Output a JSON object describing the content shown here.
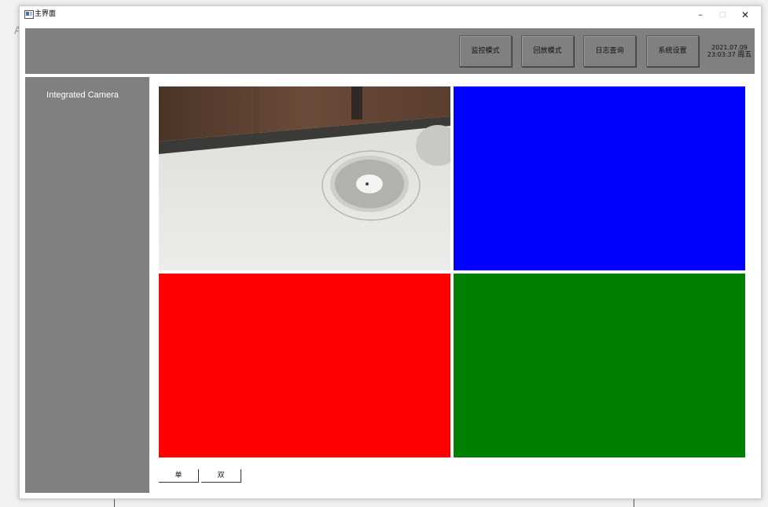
{
  "background": {
    "letter": "A"
  },
  "window": {
    "title": "主界面",
    "controls": {
      "minimize": "–",
      "maximize": "□",
      "close": "✕"
    }
  },
  "toolbar": {
    "buttons": [
      "监控模式",
      "回放模式",
      "日志查询",
      "系统设置"
    ],
    "date": "2021.07.09",
    "time": "23:03:37",
    "weekday": "周五"
  },
  "sidebar": {
    "items": [
      "Integrated Camera"
    ]
  },
  "video_grid": {
    "cells": [
      {
        "content": "camera-feed"
      },
      {
        "color": "#0000ff"
      },
      {
        "color": "#ff0000"
      },
      {
        "color": "#008000"
      }
    ]
  },
  "mode_buttons": {
    "single": "单",
    "double": "双"
  }
}
